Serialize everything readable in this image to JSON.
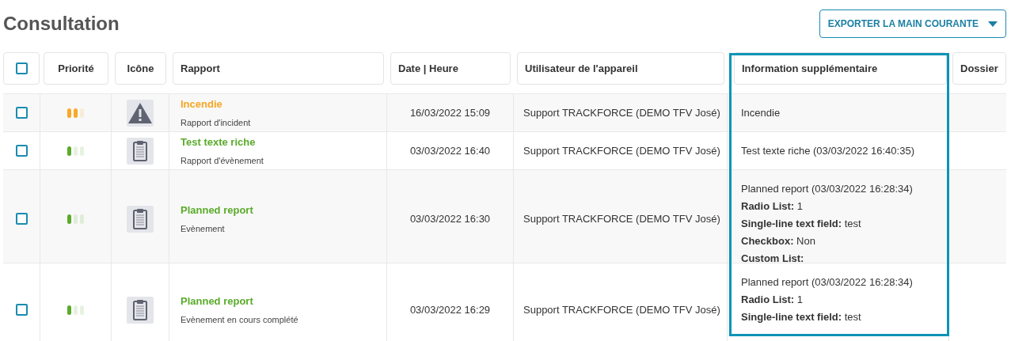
{
  "title": "Consultation",
  "export_button": {
    "label": "EXPORTER LA MAIN COURANTE"
  },
  "select_all": {
    "checked": false
  },
  "columns": [
    {
      "label": "Priorité",
      "highlighted": false
    },
    {
      "label": "Icône",
      "highlighted": false
    },
    {
      "label": "Rapport",
      "highlighted": false
    },
    {
      "label": "Date | Heure",
      "highlighted": false
    },
    {
      "label": "Utilisateur de l'appareil",
      "highlighted": false
    },
    {
      "label": "Information supplémentaire",
      "highlighted": true
    },
    {
      "label": "Dossier",
      "highlighted": false
    }
  ],
  "rows": [
    {
      "checked": false,
      "priority": {
        "level": 0.67,
        "color": "#f7a928"
      },
      "kind": "incident",
      "title": "Incendie",
      "subtitle": "Rapport d'incident",
      "date": "16/03/2022 15:09",
      "user": "Support TRACKFORCE (DEMO TFV José)",
      "info": [
        "Incendie"
      ]
    },
    {
      "checked": false,
      "priority": {
        "level": 0.33,
        "color": "#5aab2a"
      },
      "kind": "event",
      "title": "Test texte riche",
      "subtitle": "Rapport d'évènement",
      "date": "03/03/2022 16:40",
      "user": "Support TRACKFORCE (DEMO TFV José)",
      "info": [
        "Test texte riche (03/03/2022 16:40:35)"
      ]
    },
    {
      "checked": false,
      "priority": {
        "level": 0.33,
        "color": "#5aab2a"
      },
      "kind": "event",
      "title": "Planned report",
      "subtitle": "Evènement",
      "date": "03/03/2022 16:30",
      "user": "Support TRACKFORCE (DEMO TFV José)",
      "info": [
        "Planned report (03/03/2022 16:28:34)",
        "**Radio List:** 1",
        "**Single-line text field:** test",
        "**Checkbox:** Non",
        "**Custom List:**"
      ]
    },
    {
      "checked": false,
      "priority": {
        "level": 0.33,
        "color": "#5aab2a"
      },
      "kind": "event",
      "title": "Planned report",
      "subtitle": "Evènement en cours complété",
      "date": "03/03/2022 16:29",
      "user": "Support TRACKFORCE (DEMO TFV José)",
      "info": [
        "Planned report (03/03/2022 16:28:34)",
        "**Radio List:** 1",
        "**Single-line text field:** test"
      ]
    }
  ]
}
